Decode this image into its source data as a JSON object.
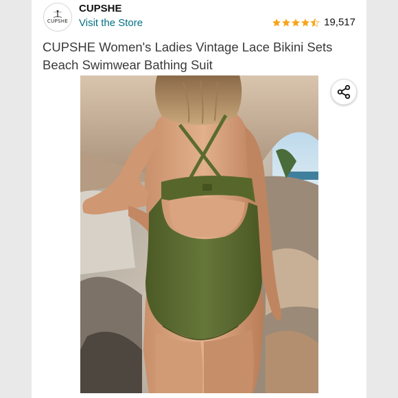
{
  "brand": {
    "logo_text": "CUPSHE",
    "name": "CUPSHE",
    "visit_link": "Visit the Store"
  },
  "rating": {
    "stars": 4.5,
    "count": "19,517",
    "star_color": "#f8a51c"
  },
  "product": {
    "title": "CUPSHE Women's Ladies Vintage Lace Bikini Sets Beach Swimwear Bathing Suit"
  },
  "colors": {
    "link": "#007185",
    "swimsuit": "#5b6b2f"
  },
  "icons": {
    "share": "share-icon",
    "logo": "palm-tree-icon"
  }
}
